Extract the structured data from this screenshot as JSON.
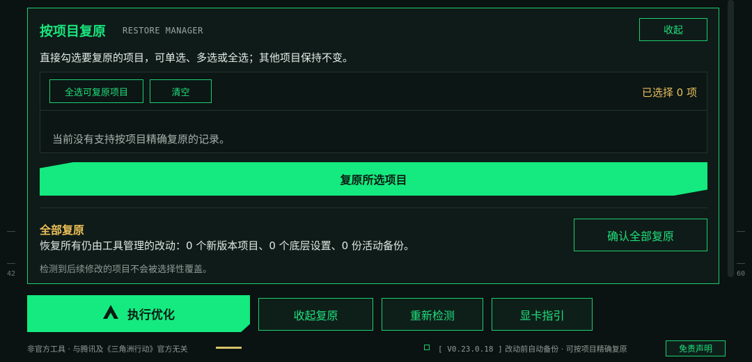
{
  "colors": {
    "accent": "#14ea7f",
    "warning": "#ecbf58",
    "background": "#0a1311",
    "panel": "#0f1b18"
  },
  "side": {
    "left_value": "42",
    "right_value": "60"
  },
  "restore": {
    "title": "按项目复原",
    "subtitle": "RESTORE MANAGER",
    "collapse_label": "收起",
    "description": "直接勾选要复原的项目，可单选、多选或全选；其他项目保持不变。",
    "select_all_label": "全选可复原项目",
    "clear_label": "清空",
    "selected_count": "已选择 0 项",
    "empty_message": "当前没有支持按项目精确复原的记录。",
    "restore_selected_label": "复原所选项目"
  },
  "full_restore": {
    "title": "全部复原",
    "description": "恢复所有仍由工具管理的改动：0 个新版本项目、0 个底层设置、0 份活动备份。",
    "note": "检测到后续修改的项目不会被选择性覆盖。",
    "confirm_label": "确认全部复原"
  },
  "actions": {
    "run_icon": "triangle-logo-icon",
    "run_label": "执行优化",
    "collapse_restore_label": "收起复原",
    "recheck_label": "重新检测",
    "gpu_guide_label": "显卡指引"
  },
  "footer": {
    "left_text": "非官方工具 · 与腾讯及《三角洲行动》官方无关",
    "version": "[ V0.23.0.18 ]",
    "right_text": "改动前自动备份 · 可按项目精确复原",
    "disclaimer_label": "免责声明"
  }
}
